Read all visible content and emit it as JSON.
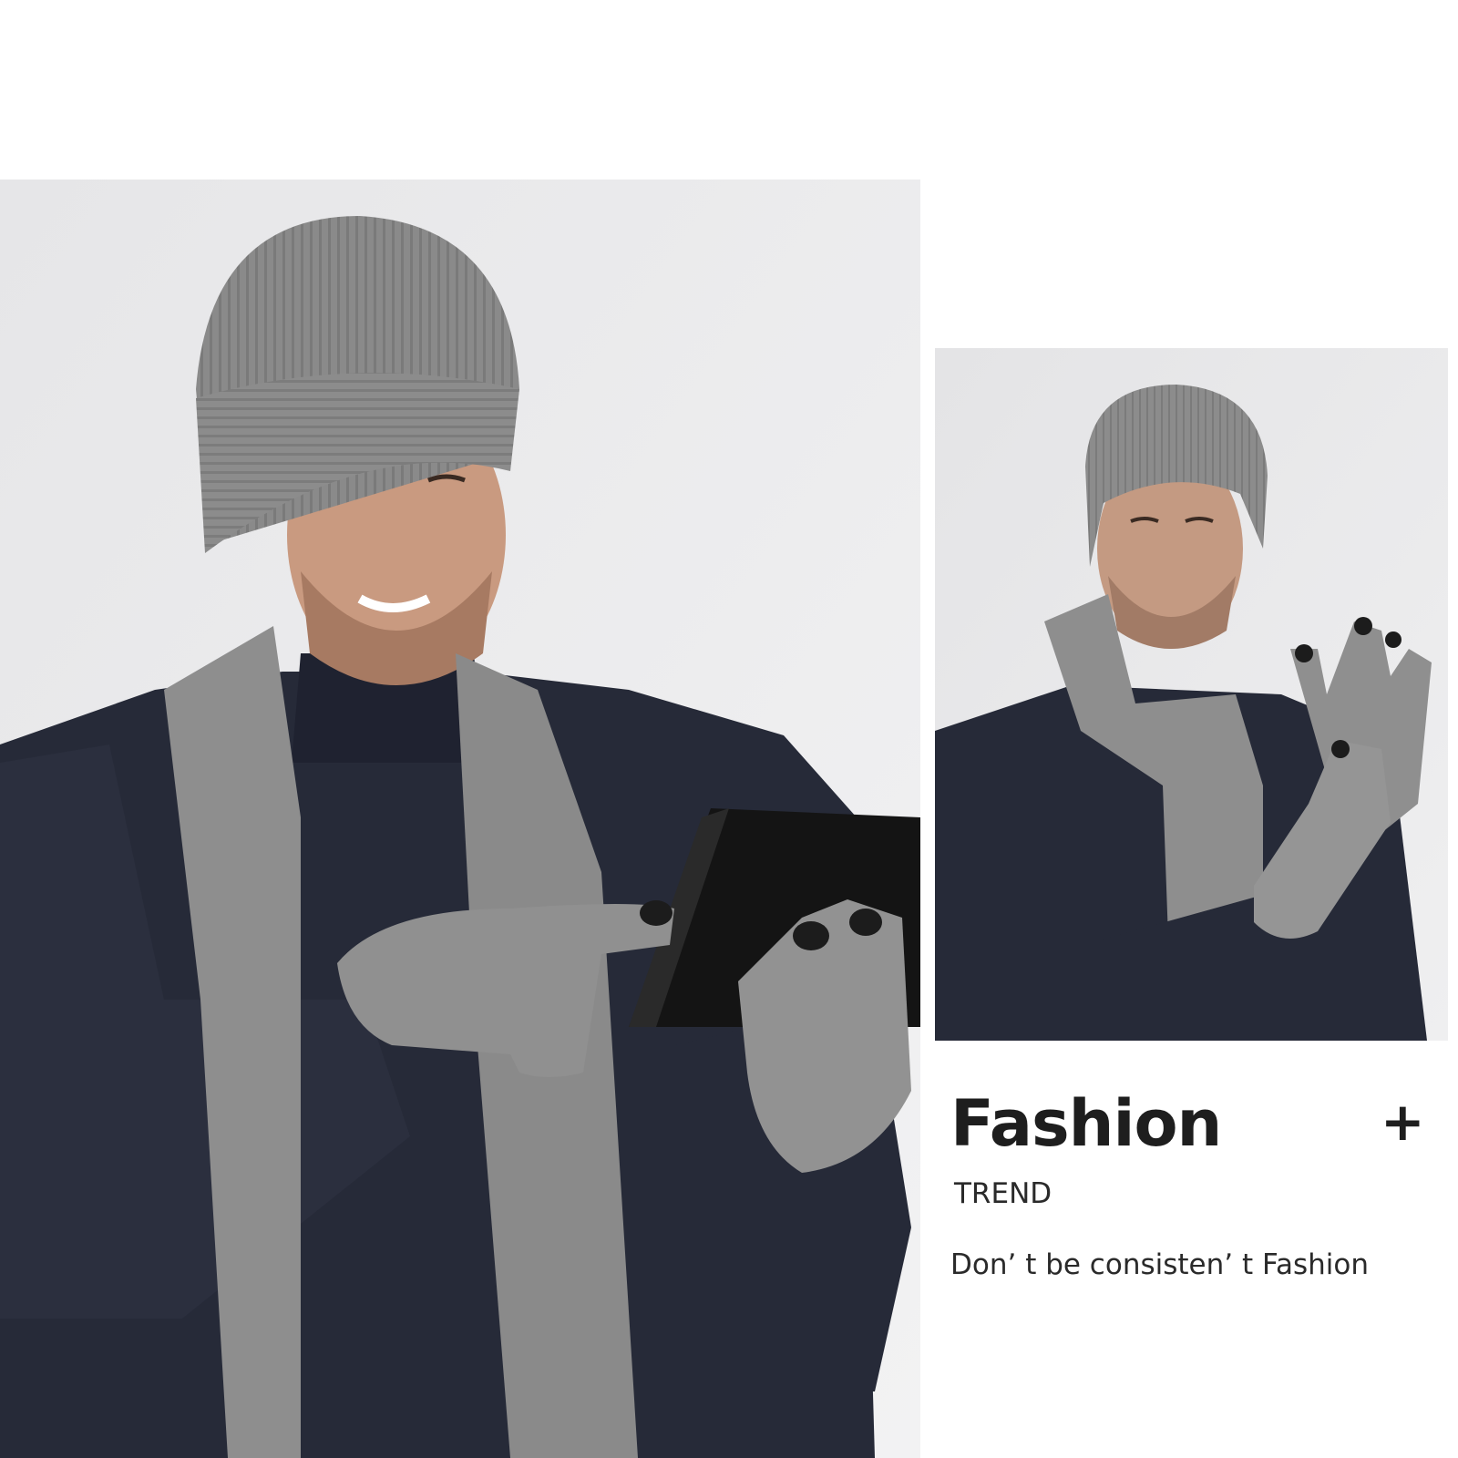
{
  "photos": {
    "main": {
      "description_icon": "man-with-tablet-photo"
    },
    "side": {
      "description_icon": "man-adjusting-gloves-photo"
    }
  },
  "caption": {
    "headline": "Fashion",
    "plus_symbol": "+",
    "subhead": "TREND",
    "tagline": "Don’ t be consisten’ t Fashion"
  },
  "colors": {
    "background": "#ffffff",
    "photo_backdrop": "#ececec",
    "knit_gray": "#8f8f8f",
    "sweater_navy": "#252937",
    "text": "#222222"
  }
}
